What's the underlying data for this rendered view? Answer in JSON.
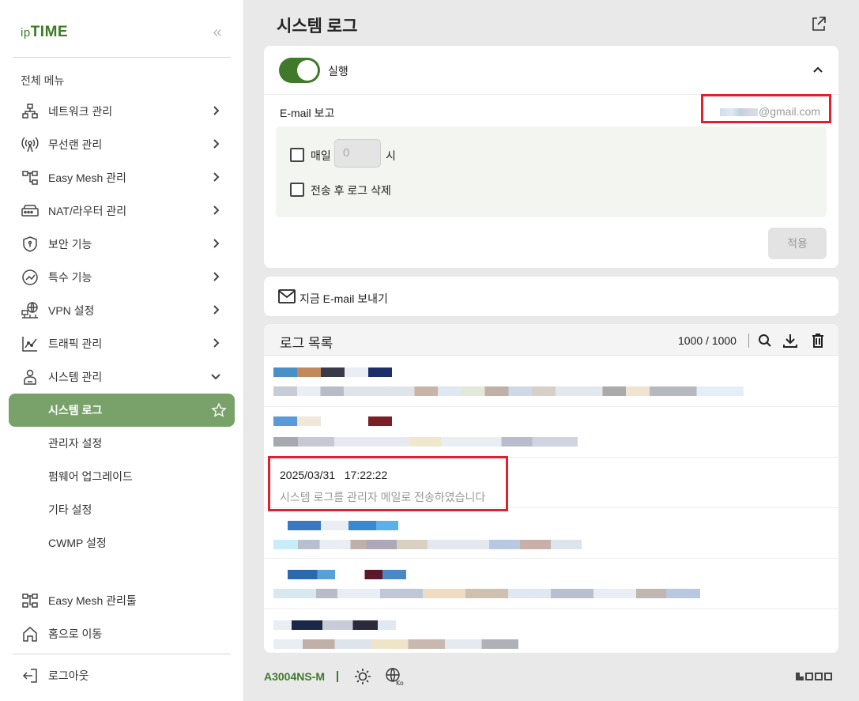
{
  "brand": {
    "logo_ip": "ip",
    "logo_time": "TIME"
  },
  "sidebar": {
    "menu_title": "전체 메뉴",
    "items": [
      {
        "label": "네트워크 관리",
        "icon": "network-icon"
      },
      {
        "label": "무선랜 관리",
        "icon": "wireless-icon"
      },
      {
        "label": "Easy Mesh 관리",
        "icon": "mesh-icon"
      },
      {
        "label": "NAT/라우터 관리",
        "icon": "router-icon"
      },
      {
        "label": "보안 기능",
        "icon": "shield-icon"
      },
      {
        "label": "특수 기능",
        "icon": "special-icon"
      },
      {
        "label": "VPN 설정",
        "icon": "vpn-icon"
      },
      {
        "label": "트래픽 관리",
        "icon": "traffic-icon"
      },
      {
        "label": "시스템 관리",
        "icon": "system-icon"
      }
    ],
    "sub_items": [
      {
        "label": "시스템 로그",
        "active": true
      },
      {
        "label": "관리자 설정"
      },
      {
        "label": "펌웨어 업그레이드"
      },
      {
        "label": "기타 설정"
      },
      {
        "label": "CWMP 설정"
      }
    ],
    "bottom": [
      {
        "label": "Easy Mesh 관리툴",
        "icon": "mesh-tool-icon"
      },
      {
        "label": "홈으로 이동",
        "icon": "home-icon"
      }
    ],
    "logout": "로그아웃"
  },
  "main": {
    "title": "시스템 로그",
    "settings": {
      "run_label": "실행",
      "run_enabled": true,
      "email_label": "E-mail 보고",
      "email_value": "@gmail.com",
      "daily_label": "매일",
      "hour_value": "0",
      "hour_unit": "시",
      "delete_label": "전송 후 로그 삭제",
      "apply_label": "적용"
    },
    "send_now_label": "지금 E-mail 보내기",
    "log": {
      "title": "로그 목록",
      "count": "1000 / 1000",
      "highlighted_entry": {
        "date": "2025/03/31",
        "time": "17:22:22",
        "message": "시스템 로그를 관리자 메일로 전송하였습니다"
      }
    }
  },
  "footer": {
    "model": "A3004NS-M"
  },
  "colors": {
    "accent": "#3f7a2a",
    "active_menu": "#78a26a",
    "highlight": "#e0202a"
  }
}
